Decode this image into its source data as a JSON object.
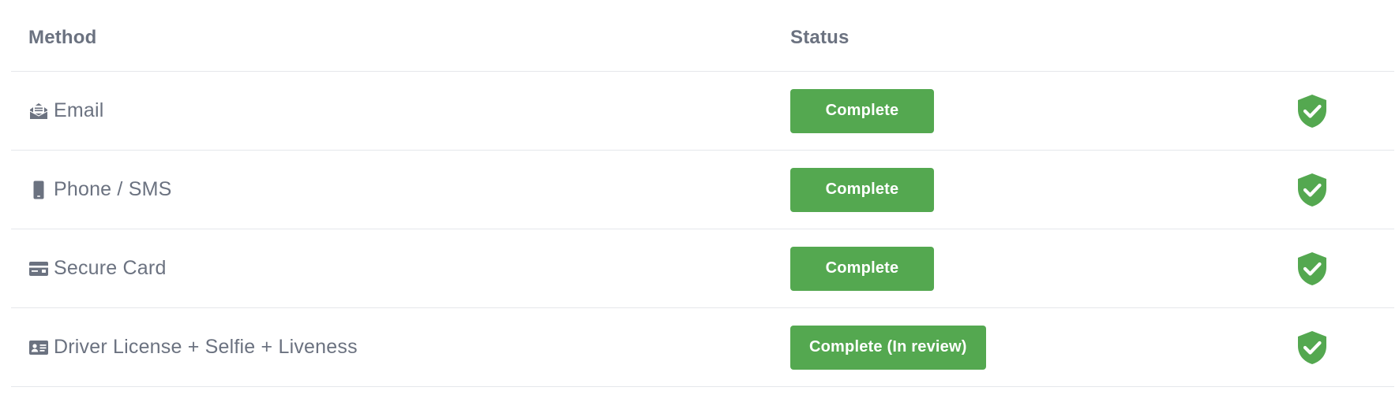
{
  "table": {
    "headers": {
      "method": "Method",
      "status": "Status"
    },
    "rows": [
      {
        "icon": "envelope-open-icon",
        "method": "Email",
        "status": "Complete",
        "verified_icon": "shield-check-icon"
      },
      {
        "icon": "mobile-phone-icon",
        "method": "Phone / SMS",
        "status": "Complete",
        "verified_icon": "shield-check-icon"
      },
      {
        "icon": "credit-card-icon",
        "method": "Secure Card",
        "status": "Complete",
        "verified_icon": "shield-check-icon"
      },
      {
        "icon": "id-card-icon",
        "method": "Driver License + Selfie + Liveness",
        "status": "Complete (In review)",
        "verified_icon": "shield-check-icon"
      }
    ]
  },
  "colors": {
    "status_green": "#54a850",
    "text_gray": "#6b7280",
    "divider": "#e5e7eb"
  }
}
